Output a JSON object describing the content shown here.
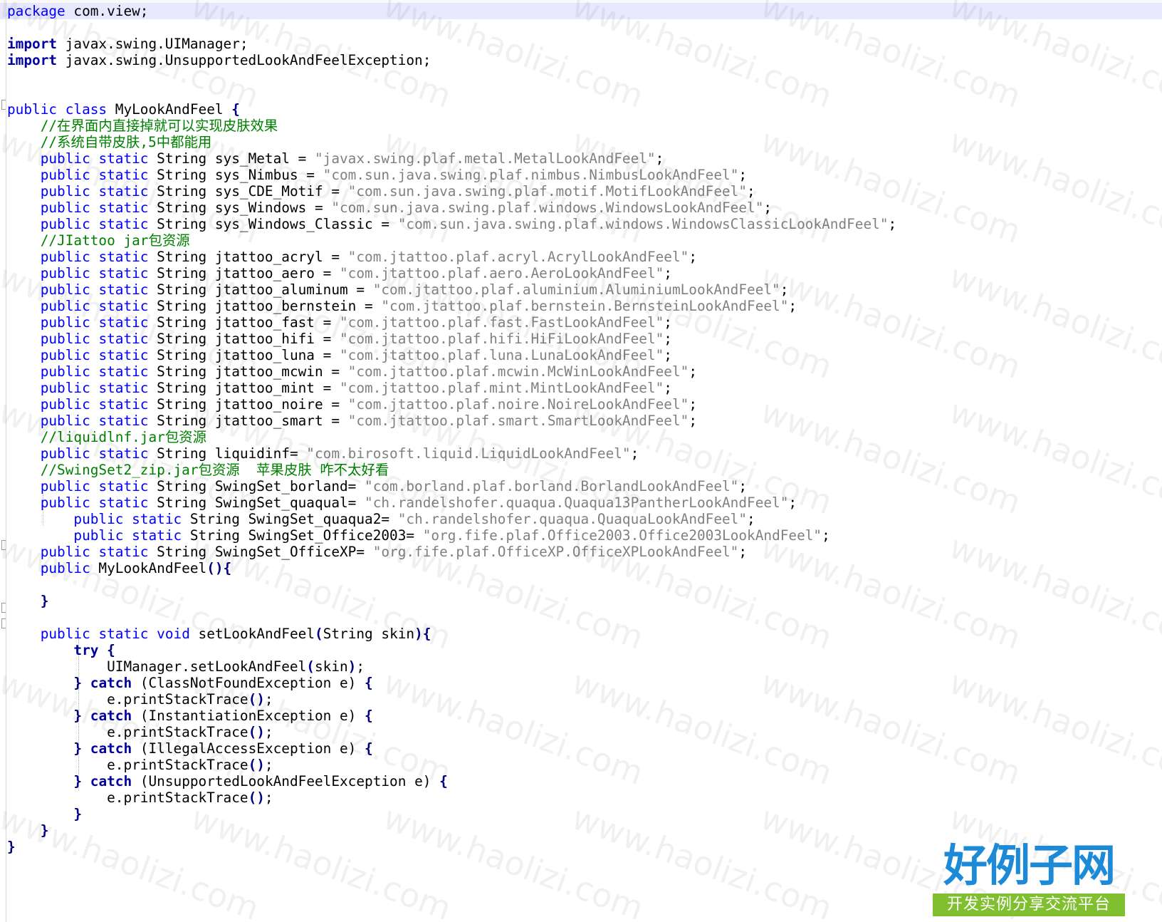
{
  "editor": {
    "colors": {
      "keyword": "#0000ff",
      "keyword_bold": "#0000a0",
      "string": "#808080",
      "comment": "#008000",
      "operator": "#000080",
      "current_line": "#e8e8ff"
    },
    "lines": [
      [
        [
          "kw",
          "package"
        ],
        [
          "txt",
          " com.view;"
        ]
      ],
      [],
      [
        [
          "kwb",
          "import"
        ],
        [
          "txt",
          " javax.swing.UIManager;"
        ]
      ],
      [
        [
          "kwb",
          "import"
        ],
        [
          "txt",
          " javax.swing.UnsupportedLookAndFeelException;"
        ]
      ],
      [],
      [],
      [
        [
          "kw",
          "public"
        ],
        [
          "txt",
          " "
        ],
        [
          "kw",
          "class"
        ],
        [
          "txt",
          " MyLookAndFeel "
        ],
        [
          "op",
          "{"
        ]
      ],
      [
        [
          "txt",
          "    "
        ],
        [
          "cmt",
          "//在界面内直接掉就可以实现皮肤效果"
        ]
      ],
      [
        [
          "txt",
          "    "
        ],
        [
          "cmt",
          "//系统自带皮肤,5中都能用"
        ]
      ],
      [
        [
          "txt",
          "    "
        ],
        [
          "kw",
          "public"
        ],
        [
          "txt",
          " "
        ],
        [
          "kw",
          "static"
        ],
        [
          "txt",
          " String sys_Metal = "
        ],
        [
          "str",
          "\"javax.swing.plaf.metal.MetalLookAndFeel\""
        ],
        [
          "txt",
          ";"
        ]
      ],
      [
        [
          "txt",
          "    "
        ],
        [
          "kw",
          "public"
        ],
        [
          "txt",
          " "
        ],
        [
          "kw",
          "static"
        ],
        [
          "txt",
          " String sys_Nimbus = "
        ],
        [
          "str",
          "\"com.sun.java.swing.plaf.nimbus.NimbusLookAndFeel\""
        ],
        [
          "txt",
          ";"
        ]
      ],
      [
        [
          "txt",
          "    "
        ],
        [
          "kw",
          "public"
        ],
        [
          "txt",
          " "
        ],
        [
          "kw",
          "static"
        ],
        [
          "txt",
          " String sys_CDE_Motif = "
        ],
        [
          "str",
          "\"com.sun.java.swing.plaf.motif.MotifLookAndFeel\""
        ],
        [
          "txt",
          ";"
        ]
      ],
      [
        [
          "txt",
          "    "
        ],
        [
          "kw",
          "public"
        ],
        [
          "txt",
          " "
        ],
        [
          "kw",
          "static"
        ],
        [
          "txt",
          " String sys_Windows = "
        ],
        [
          "str",
          "\"com.sun.java.swing.plaf.windows.WindowsLookAndFeel\""
        ],
        [
          "txt",
          ";"
        ]
      ],
      [
        [
          "txt",
          "    "
        ],
        [
          "kw",
          "public"
        ],
        [
          "txt",
          " "
        ],
        [
          "kw",
          "static"
        ],
        [
          "txt",
          " String sys_Windows_Classic = "
        ],
        [
          "str",
          "\"com.sun.java.swing.plaf.windows.WindowsClassicLookAndFeel\""
        ],
        [
          "txt",
          ";"
        ]
      ],
      [
        [
          "txt",
          "    "
        ],
        [
          "cmt",
          "//JIattoo jar包资源"
        ]
      ],
      [
        [
          "txt",
          "    "
        ],
        [
          "kw",
          "public"
        ],
        [
          "txt",
          " "
        ],
        [
          "kw",
          "static"
        ],
        [
          "txt",
          " String jtattoo_acryl = "
        ],
        [
          "str",
          "\"com.jtattoo.plaf.acryl.AcrylLookAndFeel\""
        ],
        [
          "txt",
          ";"
        ]
      ],
      [
        [
          "txt",
          "    "
        ],
        [
          "kw",
          "public"
        ],
        [
          "txt",
          " "
        ],
        [
          "kw",
          "static"
        ],
        [
          "txt",
          " String jtattoo_aero = "
        ],
        [
          "str",
          "\"com.jtattoo.plaf.aero.AeroLookAndFeel\""
        ],
        [
          "txt",
          ";"
        ]
      ],
      [
        [
          "txt",
          "    "
        ],
        [
          "kw",
          "public"
        ],
        [
          "txt",
          " "
        ],
        [
          "kw",
          "static"
        ],
        [
          "txt",
          " String jtattoo_aluminum = "
        ],
        [
          "str",
          "\"com.jtattoo.plaf.aluminium.AluminiumLookAndFeel\""
        ],
        [
          "txt",
          ";"
        ]
      ],
      [
        [
          "txt",
          "    "
        ],
        [
          "kw",
          "public"
        ],
        [
          "txt",
          " "
        ],
        [
          "kw",
          "static"
        ],
        [
          "txt",
          " String jtattoo_bernstein = "
        ],
        [
          "str",
          "\"com.jtattoo.plaf.bernstein.BernsteinLookAndFeel\""
        ],
        [
          "txt",
          ";"
        ]
      ],
      [
        [
          "txt",
          "    "
        ],
        [
          "kw",
          "public"
        ],
        [
          "txt",
          " "
        ],
        [
          "kw",
          "static"
        ],
        [
          "txt",
          " String jtattoo_fast = "
        ],
        [
          "str",
          "\"com.jtattoo.plaf.fast.FastLookAndFeel\""
        ],
        [
          "txt",
          ";"
        ]
      ],
      [
        [
          "txt",
          "    "
        ],
        [
          "kw",
          "public"
        ],
        [
          "txt",
          " "
        ],
        [
          "kw",
          "static"
        ],
        [
          "txt",
          " String jtattoo_hifi = "
        ],
        [
          "str",
          "\"com.jtattoo.plaf.hifi.HiFiLookAndFeel\""
        ],
        [
          "txt",
          ";"
        ]
      ],
      [
        [
          "txt",
          "    "
        ],
        [
          "kw",
          "public"
        ],
        [
          "txt",
          " "
        ],
        [
          "kw",
          "static"
        ],
        [
          "txt",
          " String jtattoo_luna = "
        ],
        [
          "str",
          "\"com.jtattoo.plaf.luna.LunaLookAndFeel\""
        ],
        [
          "txt",
          ";"
        ]
      ],
      [
        [
          "txt",
          "    "
        ],
        [
          "kw",
          "public"
        ],
        [
          "txt",
          " "
        ],
        [
          "kw",
          "static"
        ],
        [
          "txt",
          " String jtattoo_mcwin = "
        ],
        [
          "str",
          "\"com.jtattoo.plaf.mcwin.McWinLookAndFeel\""
        ],
        [
          "txt",
          ";"
        ]
      ],
      [
        [
          "txt",
          "    "
        ],
        [
          "kw",
          "public"
        ],
        [
          "txt",
          " "
        ],
        [
          "kw",
          "static"
        ],
        [
          "txt",
          " String jtattoo_mint = "
        ],
        [
          "str",
          "\"com.jtattoo.plaf.mint.MintLookAndFeel\""
        ],
        [
          "txt",
          ";"
        ]
      ],
      [
        [
          "txt",
          "    "
        ],
        [
          "kw",
          "public"
        ],
        [
          "txt",
          " "
        ],
        [
          "kw",
          "static"
        ],
        [
          "txt",
          " String jtattoo_noire = "
        ],
        [
          "str",
          "\"com.jtattoo.plaf.noire.NoireLookAndFeel\""
        ],
        [
          "txt",
          ";"
        ]
      ],
      [
        [
          "txt",
          "    "
        ],
        [
          "kw",
          "public"
        ],
        [
          "txt",
          " "
        ],
        [
          "kw",
          "static"
        ],
        [
          "txt",
          " String jtattoo_smart = "
        ],
        [
          "str",
          "\"com.jtattoo.plaf.smart.SmartLookAndFeel\""
        ],
        [
          "txt",
          ";"
        ]
      ],
      [
        [
          "txt",
          "    "
        ],
        [
          "cmt",
          "//liquidlnf.jar包资源"
        ]
      ],
      [
        [
          "txt",
          "    "
        ],
        [
          "kw",
          "public"
        ],
        [
          "txt",
          " "
        ],
        [
          "kw",
          "static"
        ],
        [
          "txt",
          " String liquidinf= "
        ],
        [
          "str",
          "\"com.birosoft.liquid.LiquidLookAndFeel\""
        ],
        [
          "txt",
          ";"
        ]
      ],
      [
        [
          "txt",
          "    "
        ],
        [
          "cmt",
          "//SwingSet2_zip.jar包资源  苹果皮肤 咋不太好看"
        ]
      ],
      [
        [
          "txt",
          "    "
        ],
        [
          "kw",
          "public"
        ],
        [
          "txt",
          " "
        ],
        [
          "kw",
          "static"
        ],
        [
          "txt",
          " String SwingSet_borland= "
        ],
        [
          "str",
          "\"com.borland.plaf.borland.BorlandLookAndFeel\""
        ],
        [
          "txt",
          ";"
        ]
      ],
      [
        [
          "txt",
          "    "
        ],
        [
          "kw",
          "public"
        ],
        [
          "txt",
          " "
        ],
        [
          "kw",
          "static"
        ],
        [
          "txt",
          " String SwingSet_quaqual= "
        ],
        [
          "str",
          "\"ch.randelshofer.quaqua.Quaqua13PantherLookAndFeel\""
        ],
        [
          "txt",
          ";"
        ]
      ],
      [
        [
          "txt",
          "        "
        ],
        [
          "kw",
          "public"
        ],
        [
          "txt",
          " "
        ],
        [
          "kw",
          "static"
        ],
        [
          "txt",
          " String SwingSet_quaqua2= "
        ],
        [
          "str",
          "\"ch.randelshofer.quaqua.QuaquaLookAndFeel\""
        ],
        [
          "txt",
          ";"
        ]
      ],
      [
        [
          "txt",
          "        "
        ],
        [
          "kw",
          "public"
        ],
        [
          "txt",
          " "
        ],
        [
          "kw",
          "static"
        ],
        [
          "txt",
          " String SwingSet_Office2003= "
        ],
        [
          "str",
          "\"org.fife.plaf.Office2003.Office2003LookAndFeel\""
        ],
        [
          "txt",
          ";"
        ]
      ],
      [
        [
          "txt",
          "    "
        ],
        [
          "kw",
          "public"
        ],
        [
          "txt",
          " "
        ],
        [
          "kw",
          "static"
        ],
        [
          "txt",
          " String SwingSet_OfficeXP= "
        ],
        [
          "str",
          "\"org.fife.plaf.OfficeXP.OfficeXPLookAndFeel\""
        ],
        [
          "txt",
          ";"
        ]
      ],
      [
        [
          "txt",
          "    "
        ],
        [
          "kw",
          "public"
        ],
        [
          "txt",
          " MyLookAndFeel"
        ],
        [
          "op",
          "(){"
        ]
      ],
      [],
      [
        [
          "txt",
          "    "
        ],
        [
          "op",
          "}"
        ]
      ],
      [],
      [
        [
          "txt",
          "    "
        ],
        [
          "kw",
          "public"
        ],
        [
          "txt",
          " "
        ],
        [
          "kw",
          "static"
        ],
        [
          "txt",
          " "
        ],
        [
          "kw",
          "void"
        ],
        [
          "txt",
          " setLookAndFeel"
        ],
        [
          "op",
          "("
        ],
        [
          "txt",
          "String skin"
        ],
        [
          "op",
          "){"
        ]
      ],
      [
        [
          "txt",
          "        "
        ],
        [
          "kwb",
          "try"
        ],
        [
          "txt",
          " "
        ],
        [
          "op",
          "{"
        ]
      ],
      [
        [
          "txt",
          "            UIManager.setLookAndFeel"
        ],
        [
          "op",
          "("
        ],
        [
          "txt",
          "skin"
        ],
        [
          "op",
          ")"
        ],
        [
          "txt",
          ";"
        ]
      ],
      [
        [
          "txt",
          "        "
        ],
        [
          "op",
          "}"
        ],
        [
          "txt",
          " "
        ],
        [
          "kwb",
          "catch"
        ],
        [
          "txt",
          " (ClassNotFoundException e) "
        ],
        [
          "op",
          "{"
        ]
      ],
      [
        [
          "txt",
          "            e.printStackTrace"
        ],
        [
          "op",
          "()"
        ],
        [
          "txt",
          ";"
        ]
      ],
      [
        [
          "txt",
          "        "
        ],
        [
          "op",
          "}"
        ],
        [
          "txt",
          " "
        ],
        [
          "kwb",
          "catch"
        ],
        [
          "txt",
          " (InstantiationException e) "
        ],
        [
          "op",
          "{"
        ]
      ],
      [
        [
          "txt",
          "            e.printStackTrace"
        ],
        [
          "op",
          "()"
        ],
        [
          "txt",
          ";"
        ]
      ],
      [
        [
          "txt",
          "        "
        ],
        [
          "op",
          "}"
        ],
        [
          "txt",
          " "
        ],
        [
          "kwb",
          "catch"
        ],
        [
          "txt",
          " (IllegalAccessException e) "
        ],
        [
          "op",
          "{"
        ]
      ],
      [
        [
          "txt",
          "            e.printStackTrace"
        ],
        [
          "op",
          "()"
        ],
        [
          "txt",
          ";"
        ]
      ],
      [
        [
          "txt",
          "        "
        ],
        [
          "op",
          "}"
        ],
        [
          "txt",
          " "
        ],
        [
          "kwb",
          "catch"
        ],
        [
          "txt",
          " (UnsupportedLookAndFeelException e) "
        ],
        [
          "op",
          "{"
        ]
      ],
      [
        [
          "txt",
          "            e.printStackTrace"
        ],
        [
          "op",
          "()"
        ],
        [
          "txt",
          ";"
        ]
      ],
      [
        [
          "txt",
          "        "
        ],
        [
          "op",
          "}"
        ]
      ],
      [
        [
          "txt",
          "    "
        ],
        [
          "op",
          "}"
        ]
      ],
      [
        [
          "op",
          "}"
        ]
      ]
    ]
  },
  "watermark": {
    "text": "www.haolizi.com"
  },
  "logo": {
    "title": "好例子网",
    "subtitle": "开发实例分享交流平台"
  }
}
